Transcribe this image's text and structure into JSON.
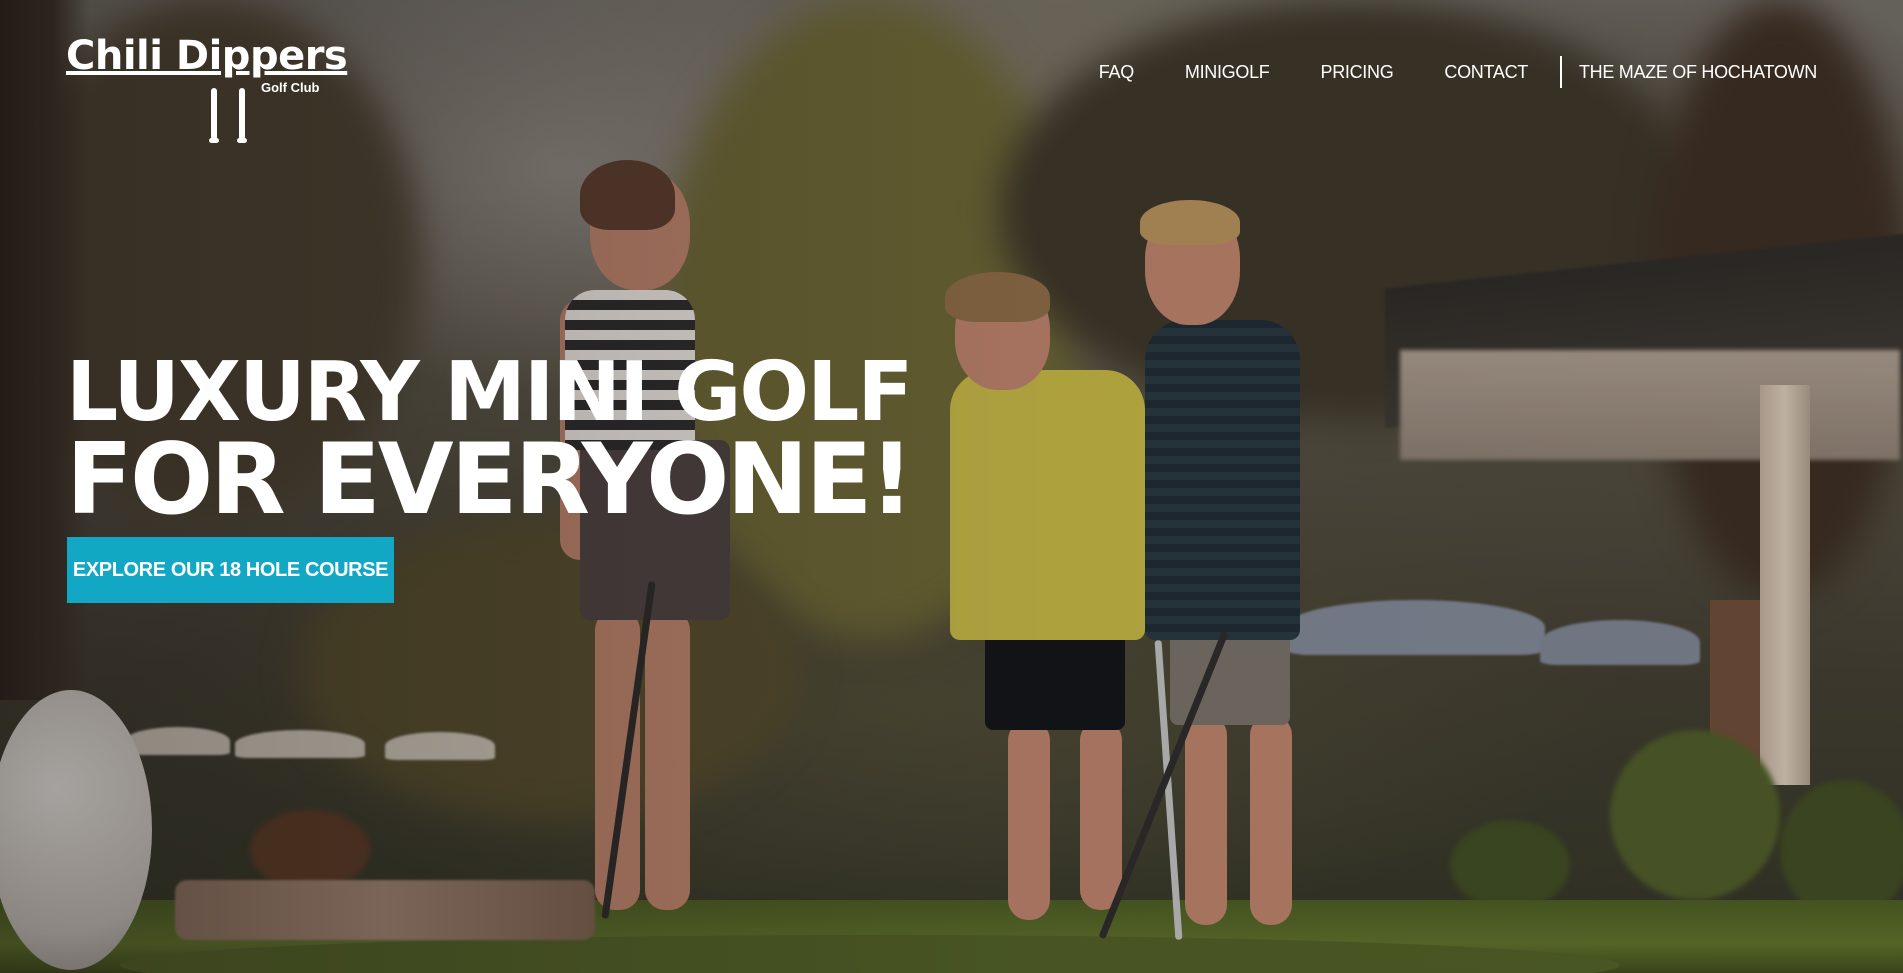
{
  "site": {
    "logo_text": "Chili Dippers",
    "logo_subtext": "Golf Club"
  },
  "nav": {
    "items": [
      {
        "label": "FAQ"
      },
      {
        "label": "MINIGOLF"
      },
      {
        "label": "PRICING"
      },
      {
        "label": "CONTACT"
      }
    ],
    "external_link": {
      "label": "THE MAZE OF HOCHATOWN"
    }
  },
  "hero": {
    "headline_line1": "LUXURY MINI GOLF",
    "headline_line2": "FOR EVERYONE!",
    "cta_label": "EXPLORE OUR 18 HOLE COURSE",
    "cta_color": "#12a7c5"
  }
}
